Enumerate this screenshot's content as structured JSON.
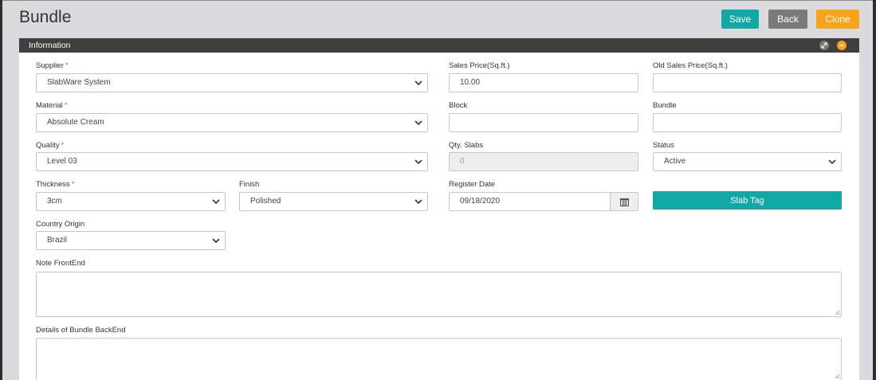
{
  "page": {
    "title": "Bundle"
  },
  "actions": {
    "save": "Save",
    "back": "Back",
    "clone": "Clone"
  },
  "panel": {
    "title": "Information"
  },
  "form": {
    "supplier": {
      "label": "Supplier",
      "required": "*",
      "value": "SlabWare System"
    },
    "material": {
      "label": "Material",
      "required": "*",
      "value": "Absolute Cream"
    },
    "quality": {
      "label": "Quality",
      "required": "*",
      "value": "Level 03"
    },
    "thickness": {
      "label": "Thickness",
      "required": "*",
      "value": "3cm"
    },
    "finish": {
      "label": "Finish",
      "value": "Polished"
    },
    "country_origin": {
      "label": "Country Origin",
      "value": "Brazil"
    },
    "sales_price": {
      "label": "Sales Price(Sq.ft.)",
      "value": "10.00"
    },
    "old_sales_price": {
      "label": "Old Sales Price(Sq.ft.)",
      "value": ""
    },
    "block": {
      "label": "Block",
      "value": ""
    },
    "bundle": {
      "label": "Bundle",
      "value": ""
    },
    "qty_slabs": {
      "label": "Qty. Slabs",
      "value": "0"
    },
    "status": {
      "label": "Status",
      "value": "Active"
    },
    "register_date": {
      "label": "Register Date",
      "value": "09/18/2020"
    },
    "slab_tag": "Slab Tag",
    "note_frontend": {
      "label": "Note FrontEnd",
      "value": ""
    },
    "details_backend": {
      "label": "Details of Bundle BackEnd",
      "value": ""
    }
  },
  "colors": {
    "teal": "#12a8a5",
    "gray": "#7a7a7a",
    "orange": "#f7a31c",
    "header": "#3f3f3f",
    "required": "#d9534f"
  },
  "icons": {
    "select": "chevron-down-icon",
    "date": "calendar-icon",
    "expand": "expand-icon",
    "collapse": "collapse-icon"
  }
}
